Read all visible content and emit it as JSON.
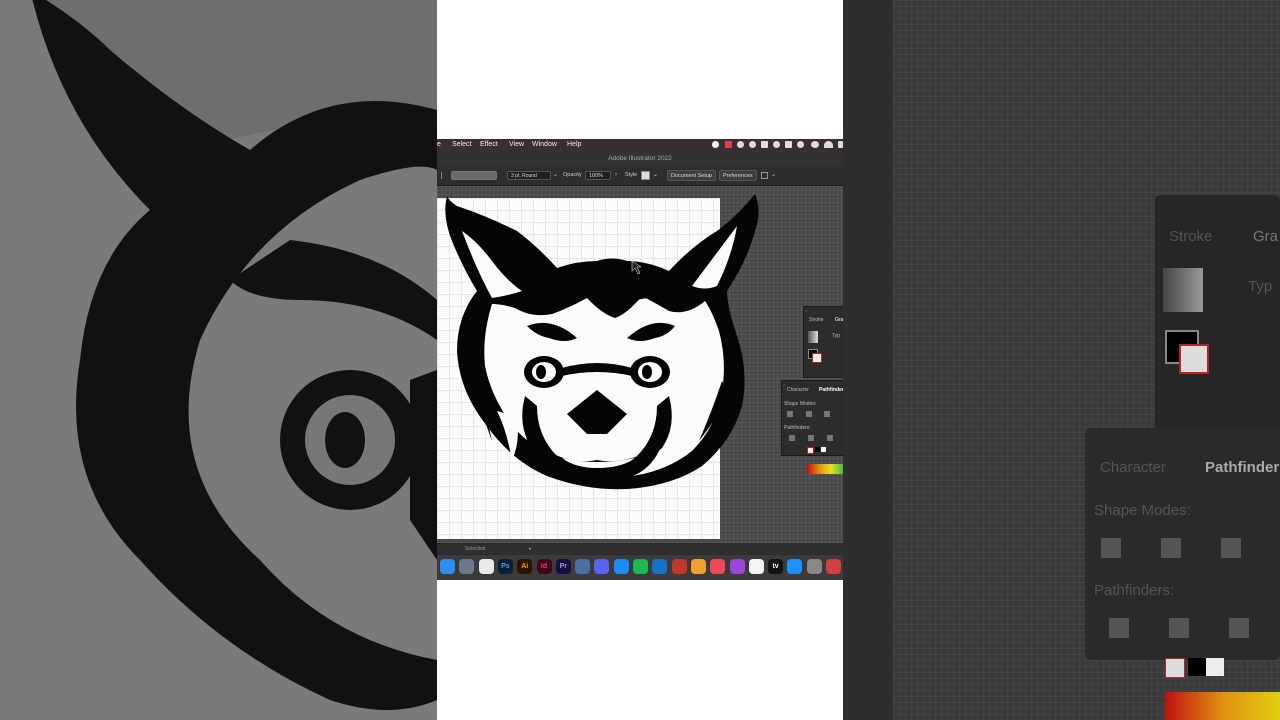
{
  "menubar": {
    "items": [
      "e",
      "Select",
      "Effect",
      "View",
      "Window",
      "Help"
    ]
  },
  "window": {
    "title": "Adobe Illustrator 2022"
  },
  "control_bar": {
    "stroke_profile": "3 pt. Round",
    "opacity_label": "Opacity",
    "opacity_value": "100%",
    "style_label": "Style",
    "document_setup": "Document Setup",
    "preferences": "Preferences"
  },
  "panels": {
    "stroke_tab": "Stroke",
    "gradient_tab": "Gra",
    "type_label": "Typ",
    "character_tab": "Character",
    "pathfinder_tab": "Pathfinder",
    "shape_modes": "Shape Modes:",
    "pathfinders": "Pathfinders:"
  },
  "status": {
    "tool": "Selection"
  },
  "dock": {
    "apps": [
      {
        "name": "finder",
        "label": "",
        "color": "#2d8ef0"
      },
      {
        "name": "screenshot",
        "label": "",
        "color": "#6b7a8a"
      },
      {
        "name": "chrome",
        "label": "",
        "color": "#e9e9e9"
      },
      {
        "name": "photoshop",
        "label": "Ps",
        "color": "#0b1f33"
      },
      {
        "name": "illustrator",
        "label": "Ai",
        "color": "#2b1400"
      },
      {
        "name": "indesign",
        "label": "Id",
        "color": "#3a0a1c"
      },
      {
        "name": "premiere",
        "label": "Pr",
        "color": "#16103a"
      },
      {
        "name": "preview",
        "label": "",
        "color": "#4a6fa5"
      },
      {
        "name": "discord",
        "label": "",
        "color": "#5865f2"
      },
      {
        "name": "safari",
        "label": "",
        "color": "#1d8cf5"
      },
      {
        "name": "spotify",
        "label": "",
        "color": "#1db954"
      },
      {
        "name": "edge",
        "label": "",
        "color": "#1572c4"
      },
      {
        "name": "photo-booth",
        "label": "",
        "color": "#c0392b"
      },
      {
        "name": "pages",
        "label": "",
        "color": "#f0a030"
      },
      {
        "name": "music",
        "label": "",
        "color": "#f04858"
      },
      {
        "name": "podcasts",
        "label": "",
        "color": "#9b45d9"
      },
      {
        "name": "news",
        "label": "",
        "color": "#f4f4f4"
      },
      {
        "name": "apple-tv",
        "label": "tv",
        "color": "#111111"
      },
      {
        "name": "app-store",
        "label": "",
        "color": "#1e90ff"
      },
      {
        "name": "system-preferences",
        "label": "",
        "color": "#888888"
      },
      {
        "name": "trash",
        "label": "",
        "color": "#d04040"
      }
    ]
  },
  "background_panels": {
    "stroke_tab": "Stroke",
    "gradient_tab": "Gra",
    "type_label": "Typ",
    "character_tab": "Character",
    "pathfinder_tab": "Pathfinder",
    "shape_modes": "Shape Modes:",
    "pathfinders": "Pathfinders:"
  }
}
